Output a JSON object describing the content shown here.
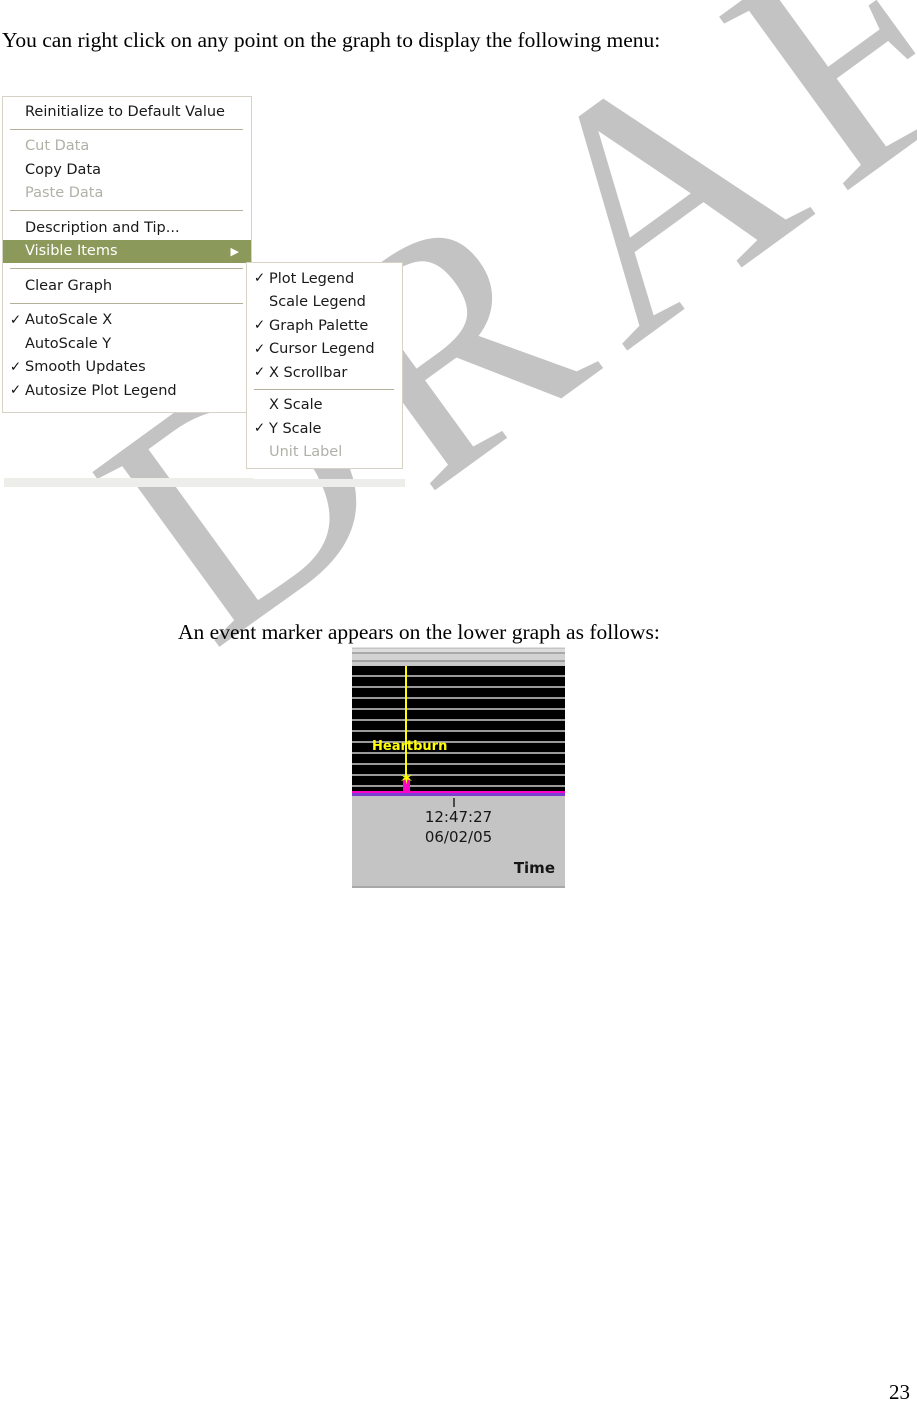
{
  "document": {
    "intro_paragraph": "You can right click on any point on the graph to display the following menu:",
    "marker_paragraph": "An event marker appears on the lower graph as follows:",
    "page_number": "23",
    "watermark_text": "DRAFT"
  },
  "colors": {
    "menu_highlight": "#8b9a5b",
    "menu_border": "#d6d3c4",
    "menu_separator": "#b3b09c",
    "disabled_text": "#b1b1a8",
    "event_label": "#ffff00",
    "event_bar": "#ff00c8",
    "baseline_purple": "#7a3fd0",
    "plot_background": "#000000",
    "gridline": "#9a9a9a",
    "watermark": "#c3c3c3"
  },
  "context_menu": {
    "name": "graph-right-click-menu",
    "groups": [
      {
        "items": [
          {
            "label": "Reinitialize to Default Value",
            "checked": false,
            "disabled": false,
            "highlighted": false,
            "submenu": false
          }
        ]
      },
      {
        "items": [
          {
            "label": "Cut Data",
            "checked": false,
            "disabled": true,
            "highlighted": false,
            "submenu": false
          },
          {
            "label": "Copy Data",
            "checked": false,
            "disabled": false,
            "highlighted": false,
            "submenu": false
          },
          {
            "label": "Paste Data",
            "checked": false,
            "disabled": true,
            "highlighted": false,
            "submenu": false
          }
        ]
      },
      {
        "items": [
          {
            "label": "Description and Tip...",
            "checked": false,
            "disabled": false,
            "highlighted": false,
            "submenu": false
          },
          {
            "label": "Visible Items",
            "checked": false,
            "disabled": false,
            "highlighted": true,
            "submenu": true,
            "arrow": "▶"
          }
        ]
      },
      {
        "items": [
          {
            "label": "Clear Graph",
            "checked": false,
            "disabled": false,
            "highlighted": false,
            "submenu": false
          }
        ]
      },
      {
        "items": [
          {
            "label": "AutoScale X",
            "checked": true,
            "disabled": false,
            "highlighted": false,
            "submenu": false
          },
          {
            "label": "AutoScale Y",
            "checked": false,
            "disabled": false,
            "highlighted": false,
            "submenu": false
          },
          {
            "label": "Smooth Updates",
            "checked": true,
            "disabled": false,
            "highlighted": false,
            "submenu": false
          },
          {
            "label": "Autosize Plot Legend",
            "checked": true,
            "disabled": false,
            "highlighted": false,
            "submenu": false
          }
        ]
      }
    ]
  },
  "submenu": {
    "name": "visible-items-submenu",
    "groups": [
      {
        "items": [
          {
            "label": "Plot Legend",
            "checked": true,
            "disabled": false
          },
          {
            "label": "Scale Legend",
            "checked": false,
            "disabled": false
          },
          {
            "label": "Graph Palette",
            "checked": true,
            "disabled": false
          },
          {
            "label": "Cursor Legend",
            "checked": true,
            "disabled": false
          },
          {
            "label": "X Scrollbar",
            "checked": true,
            "disabled": false
          }
        ]
      },
      {
        "items": [
          {
            "label": "X Scale",
            "checked": false,
            "disabled": false
          },
          {
            "label": "Y Scale",
            "checked": true,
            "disabled": false
          },
          {
            "label": "Unit Label",
            "checked": false,
            "disabled": true
          }
        ]
      }
    ]
  },
  "graph": {
    "name": "event-marker-graph",
    "event_label": "Heartburn",
    "event_marker_glyph": "✶",
    "time_value": "12:47:27",
    "date_value": "06/02/05",
    "axis_title": "Time",
    "gridline_count": 11,
    "has_x_scrollbar": true
  },
  "chart_data": {
    "type": "line",
    "title": "",
    "xlabel": "Time",
    "ylabel": "",
    "grid": true,
    "legend": "none",
    "annotations": [
      {
        "text": "Heartburn",
        "color": "#ffff00",
        "x": "12:47:27",
        "marker": "x-cross",
        "cursor_line": true
      }
    ],
    "x_tick_labels": [
      "12:47:27\n06/02/05"
    ],
    "series": [
      {
        "name": "event-pulse",
        "color": "#ff00c8",
        "values": [
          0,
          0,
          0,
          1,
          0,
          0,
          0
        ]
      },
      {
        "name": "baseline",
        "color": "#7a3fd0",
        "values": [
          0,
          0,
          0,
          0,
          0,
          0,
          0
        ]
      }
    ]
  }
}
